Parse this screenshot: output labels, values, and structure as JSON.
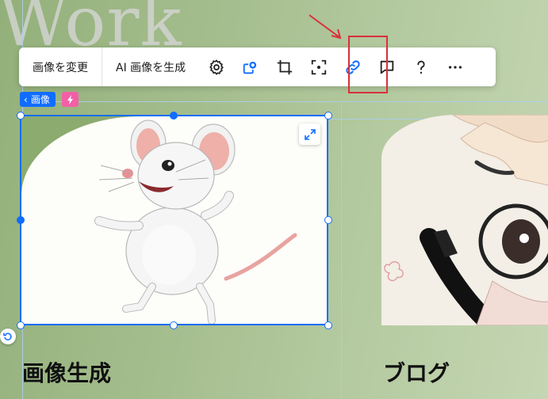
{
  "background_title": "Work",
  "toolbar": {
    "change_image": "画像を変更",
    "generate_ai_image": "AI 画像を生成",
    "icons": [
      "gear-icon",
      "animation-icon",
      "crop-icon",
      "focal-point-icon",
      "link-icon",
      "comment-icon",
      "help-icon",
      "more-icon"
    ]
  },
  "selection": {
    "tag_label": "画像",
    "tag_back": "‹"
  },
  "captions": {
    "left": "画像生成",
    "right": "ブログ"
  },
  "colors": {
    "accent": "#116dff",
    "link_icon": "#116dff",
    "annotation": "#d8303a",
    "bolt_badge": "#f35fa7"
  }
}
